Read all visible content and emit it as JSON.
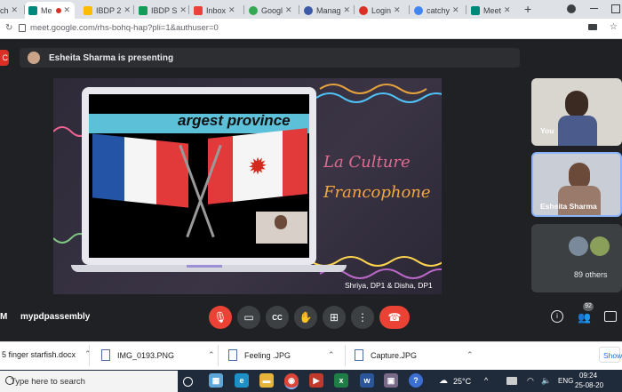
{
  "browser": {
    "tabs": [
      {
        "label": "ch",
        "icon": "web-icon",
        "color": "#5f6368"
      },
      {
        "label": "Me",
        "icon": "google-meet-icon",
        "color": "#00897b",
        "active": true
      },
      {
        "label": "IBDP 2",
        "icon": "google-drive-icon",
        "color": "#fbbc04"
      },
      {
        "label": "IBDP S",
        "icon": "google-sheets-icon",
        "color": "#0f9d58"
      },
      {
        "label": "Inbox",
        "icon": "gmail-icon",
        "color": "#ea4335"
      },
      {
        "label": "Googl",
        "icon": "google-icon",
        "color": "#34a853"
      },
      {
        "label": "Manag",
        "icon": "web-icon",
        "color": "#3c5aa6"
      },
      {
        "label": "Login",
        "icon": "web-icon",
        "color": "#d93025"
      },
      {
        "label": "catchy",
        "icon": "google-icon",
        "color": "#4285f4"
      },
      {
        "label": "Meet",
        "icon": "google-meet-icon",
        "color": "#00897b"
      }
    ],
    "new_tab": "+",
    "url": "meet.google.com/rhs-bohq-hap?pli=1&authuser=0"
  },
  "meet": {
    "presenting_text": "Esheita Sharma is presenting",
    "slide": {
      "banner_text": "argest province",
      "title_line1": "La Culture",
      "title_line2": "Francophone",
      "credit": "Shriya, DP1 & Disha, DP1"
    },
    "participants": [
      {
        "name": "You"
      },
      {
        "name": "Esheita Sharma"
      }
    ],
    "others_label": "89 others",
    "meeting_name": "mypdpassembly",
    "meeting_prefix": "M",
    "people_count": "92",
    "controls": [
      "mic-off-icon",
      "camera-icon",
      "captions-icon",
      "raise-hand-icon",
      "present-icon",
      "more-icon",
      "end-call-icon"
    ]
  },
  "downloads": {
    "items": [
      {
        "name": "5 finger starfish.docx",
        "icon": "word-doc-icon"
      },
      {
        "name": "IMG_0193.PNG",
        "icon": "image-file-icon"
      },
      {
        "name": "Feeling .JPG",
        "icon": "image-file-icon"
      },
      {
        "name": "Capture.JPG",
        "icon": "image-file-icon"
      }
    ],
    "show_all": "Show"
  },
  "taskbar": {
    "search_placeholder": "Type here to search",
    "weather": "25°C",
    "language": "ENG",
    "time": "09:24",
    "date": "25-08-20"
  },
  "colors": {
    "meet_bg": "#202124",
    "end_call": "#ea4335",
    "mic_off": "#ea4335",
    "slide_bg": "#332e3f"
  }
}
